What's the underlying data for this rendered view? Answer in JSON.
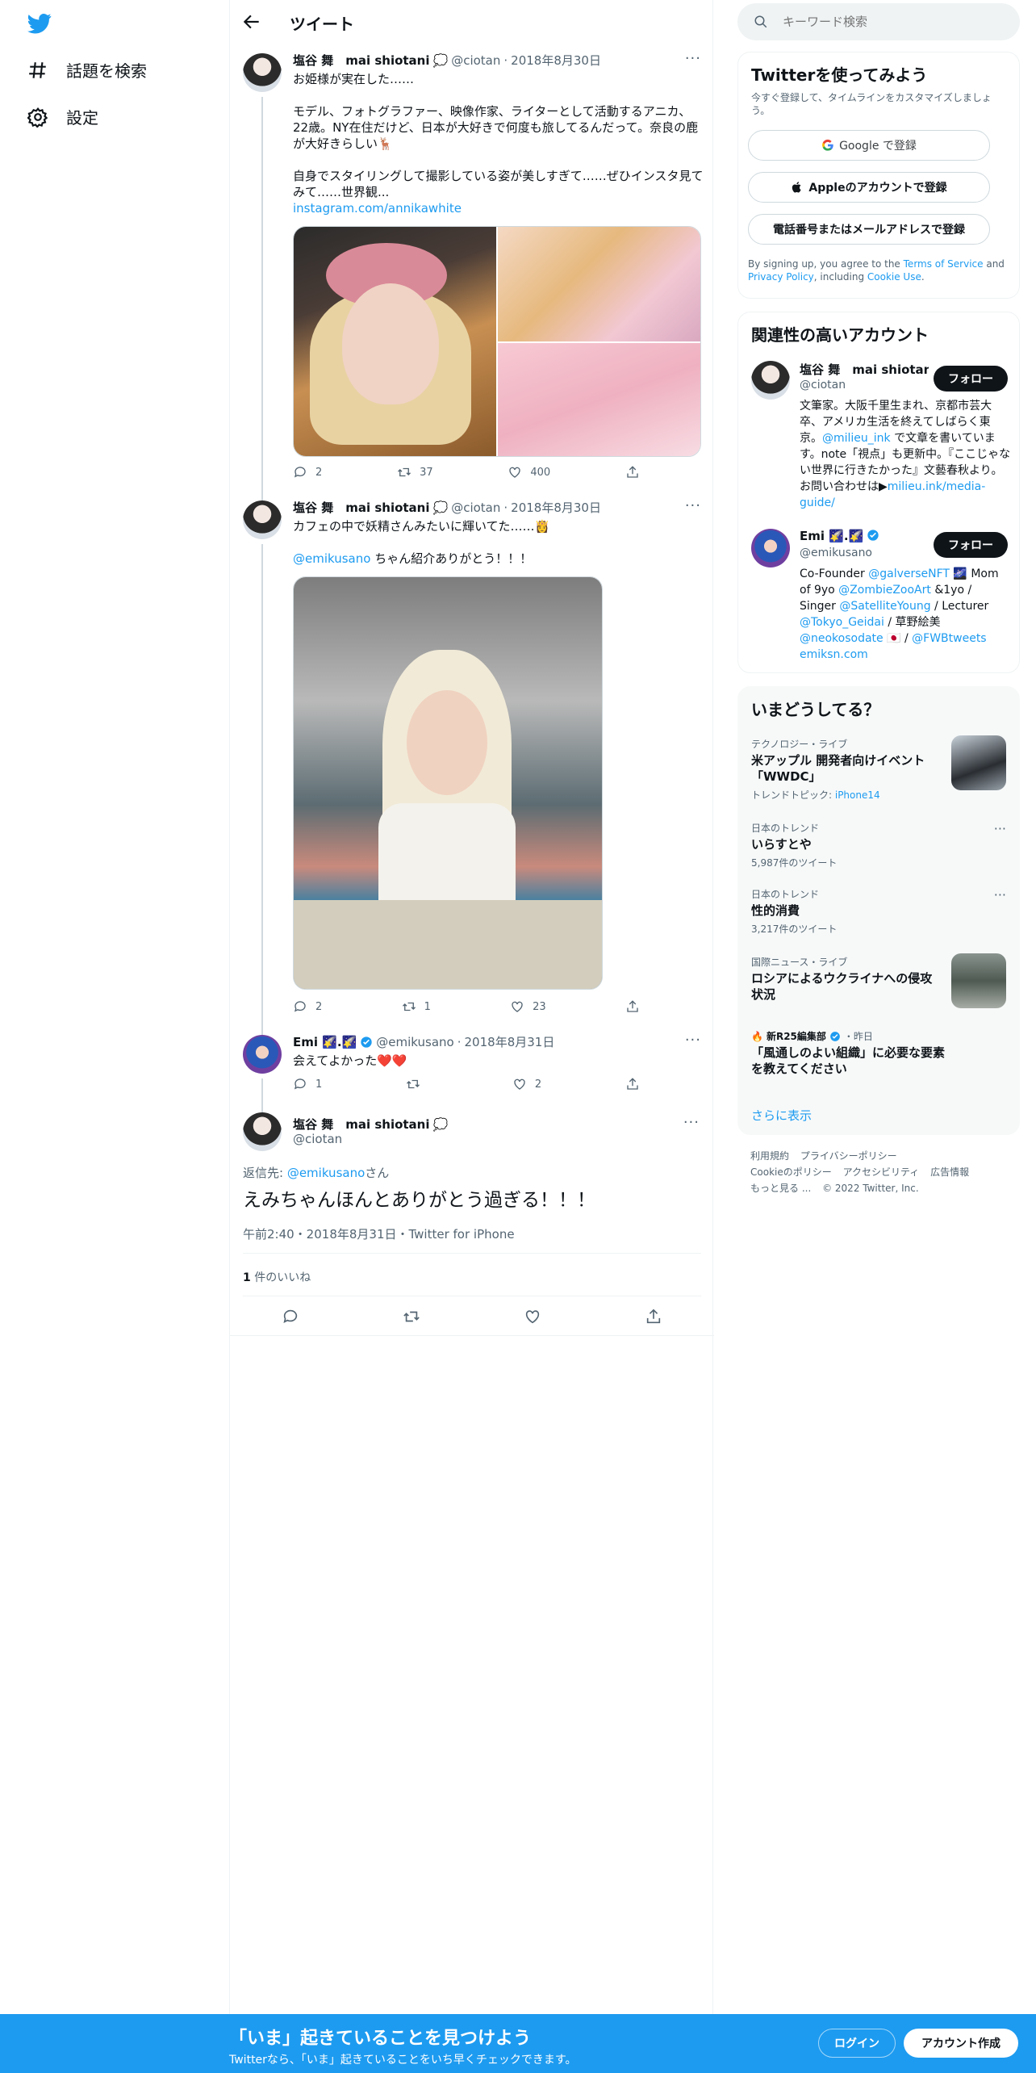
{
  "nav": {
    "explore_label": "話題を検索",
    "settings_label": "設定"
  },
  "header": {
    "title": "ツイート"
  },
  "tweets": [
    {
      "name": "塩谷 舞　mai shiotani",
      "badge": "💭",
      "handle": "@ciotan",
      "date": "2018年8月30日",
      "text": "お姫様が実在した……\n\nモデル、フォトグラファー、映像作家、ライターとして活動するアニカ、22歳。NY在住だけど、日本が大好きで何度も旅してるんだって。奈良の鹿が大好きらしい🦌\n\n自身でスタイリングして撮影している姿が美しすぎて……ぜひインスタ見てみて……世界観...",
      "link": "instagram.com/annikawhite",
      "replies": "2",
      "retweets": "37",
      "likes": "400"
    },
    {
      "name": "塩谷 舞　mai shiotani",
      "badge": "💭",
      "handle": "@ciotan",
      "date": "2018年8月30日",
      "text": "カフェの中で妖精さんみたいに輝いてた……👸",
      "mention": "@emikusano",
      "text2": " ちゃん紹介ありがとう！！！",
      "replies": "2",
      "retweets": "1",
      "likes": "23"
    },
    {
      "name": "Emi 🌠.🌠",
      "handle": "@emikusano",
      "date": "2018年8月31日",
      "text": "会えてよかった❤️❤️",
      "replies": "1",
      "retweets": "",
      "likes": "2"
    }
  ],
  "focus": {
    "name": "塩谷 舞　mai shiotani",
    "badge": "💭",
    "handle": "@ciotan",
    "reply_prefix": "返信先: ",
    "reply_mention": "@emikusano",
    "reply_suffix": "さん",
    "text": "えみちゃんほんとありがとう過ぎる！！！",
    "meta": "午前2:40・2018年8月31日・Twitter for iPhone",
    "likes_count": "1",
    "likes_label": " 件のいいね"
  },
  "search": {
    "placeholder": "キーワード検索"
  },
  "signup_card": {
    "title": "Twitterを使ってみよう",
    "subtitle": "今すぐ登録して、タイムラインをカスタマイズしましょう。",
    "google": "Google で登録",
    "apple": "Appleのアカウントで登録",
    "phone": "電話番号またはメールアドレスで登録",
    "terms_1": "By signing up, you agree to the ",
    "terms_tos": "Terms of Service",
    "terms_2": " and ",
    "terms_pp": "Privacy Policy",
    "terms_3": ", including ",
    "terms_cookie": "Cookie Use",
    "terms_4": "."
  },
  "related": {
    "title": "関連性の高いアカウント",
    "accounts": [
      {
        "name": "塩谷 舞　mai shiotan...",
        "handle": "@ciotan",
        "follow": "フォロー",
        "bio_1": "文筆家。大阪千里生まれ、京都市芸大卒、アメリカ生活を終えてしばらく東京。",
        "bio_mention": "@milieu_ink",
        "bio_2": " で文章を書いています。note「視点」も更新中。『ここじゃない世界に行きたかった』文藝春秋より。お問い合わせは▶",
        "bio_link": "milieu.ink/media-guide/"
      },
      {
        "name": "Emi 🌠.🌠",
        "handle": "@emikusano",
        "follow": "フォロー",
        "bio_a": "Co-Founder ",
        "bio_m1": "@galverseNFT",
        "bio_b": " 🌌 Mom of 9yo ",
        "bio_m2": "@ZombieZooArt",
        "bio_c": " &1yo / Singer ",
        "bio_m3": "@SatelliteYoung",
        "bio_d": " / Lecturer ",
        "bio_m4": "@Tokyo_Geidai",
        "bio_e": " / 草野絵美 ",
        "bio_m5": "@neokosodate",
        "bio_f": " 🇯🇵 / ",
        "bio_m6": "@FWBtweets",
        "bio_link": "emiksn.com"
      }
    ]
  },
  "trends": {
    "title": "いまどうしてる？",
    "items": [
      {
        "category": "テクノロジー・ライブ",
        "title": "米アップル 開発者向けイベント「WWDC」",
        "sub_prefix": "トレンドトピック: ",
        "sub_link": "iPhone14"
      },
      {
        "category": "日本のトレンド",
        "title": "いらすとや",
        "sub": "5,987件のツイート"
      },
      {
        "category": "日本のトレンド",
        "title": "性的消費",
        "sub": "3,217件のツイート"
      },
      {
        "category": "国際ニュース・ライブ",
        "title": "ロシアによるウクライナへの侵攻状況"
      },
      {
        "category": "新R25編集部",
        "category_suffix": "・昨日",
        "title": "「風通しのよい組織」に必要な要素を教えてください"
      }
    ],
    "show_more": "さらに表示"
  },
  "footer": {
    "links": [
      "利用規約",
      "プライバシーポリシー",
      "Cookieのポリシー",
      "アクセシビリティ",
      "広告情報",
      "もっと見る ..."
    ],
    "copyright": "© 2022 Twitter, Inc."
  },
  "bottom_bar": {
    "title": "「いま」起きていることを見つけよう",
    "subtitle": "Twitterなら、「いま」起きていることをいち早くチェックできます。",
    "login": "ログイン",
    "signup": "アカウント作成"
  },
  "colors": {
    "accent": "#1d9bf0",
    "text": "#0f1419",
    "muted": "#536471"
  }
}
